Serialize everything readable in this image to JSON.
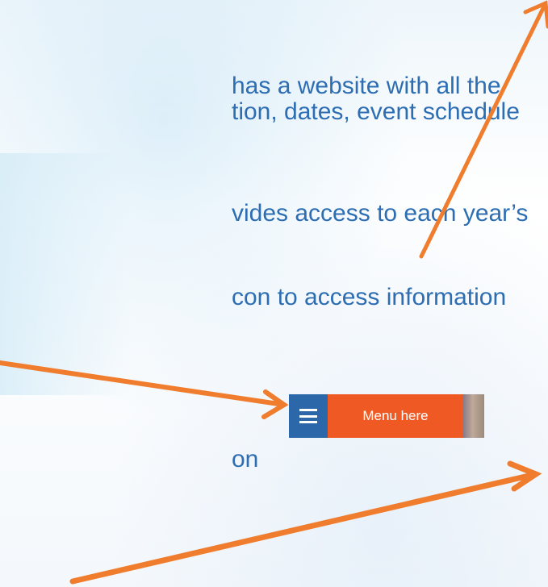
{
  "slide": {
    "lines": [
      "has a website with all the",
      "tion, dates, event schedule",
      "vides access to each year’s",
      "con to access information",
      "on"
    ]
  },
  "menu_widget": {
    "icon": "hamburger-menu-icon",
    "label": "Menu here",
    "colors": {
      "icon_bg": "#2c68a9",
      "label_bg": "#ef5a24"
    }
  },
  "arrows": {
    "color": "#ef7d2d",
    "items": [
      "arrow-up-right",
      "arrow-to-menu",
      "arrow-lower-right"
    ]
  }
}
